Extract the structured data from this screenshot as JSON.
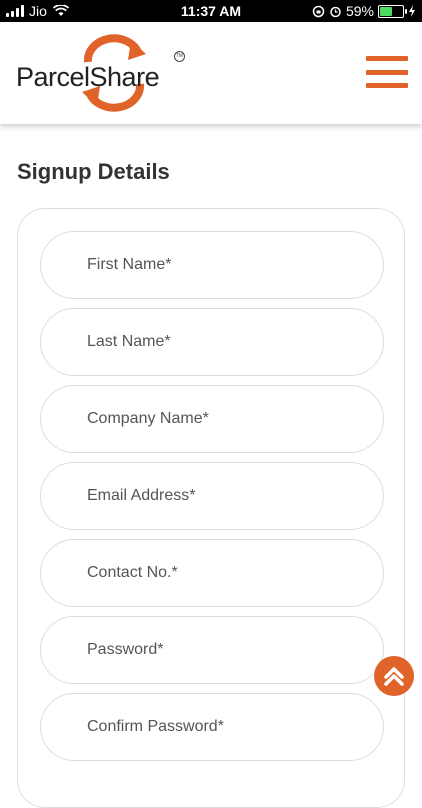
{
  "status_bar": {
    "carrier": "Jio",
    "time": "11:37 AM",
    "battery": "59%",
    "battery_level": 0.59
  },
  "header": {
    "logo_text": "ParcelShare",
    "logo_tm": "TM",
    "brand_color": "#e0642a"
  },
  "page": {
    "title": "Signup Details"
  },
  "form": {
    "fields": [
      {
        "placeholder": "First Name*",
        "value": ""
      },
      {
        "placeholder": "Last Name*",
        "value": ""
      },
      {
        "placeholder": "Company Name*",
        "value": ""
      },
      {
        "placeholder": "Email Address*",
        "value": ""
      },
      {
        "placeholder": "Contact No.*",
        "value": ""
      },
      {
        "placeholder": "Password*",
        "value": ""
      },
      {
        "placeholder": "Confirm Password*",
        "value": ""
      }
    ]
  },
  "icons": {
    "menu": "hamburger-menu-icon",
    "scroll_top": "chevron-up-icon",
    "logo": "recycle-arrows-icon"
  }
}
